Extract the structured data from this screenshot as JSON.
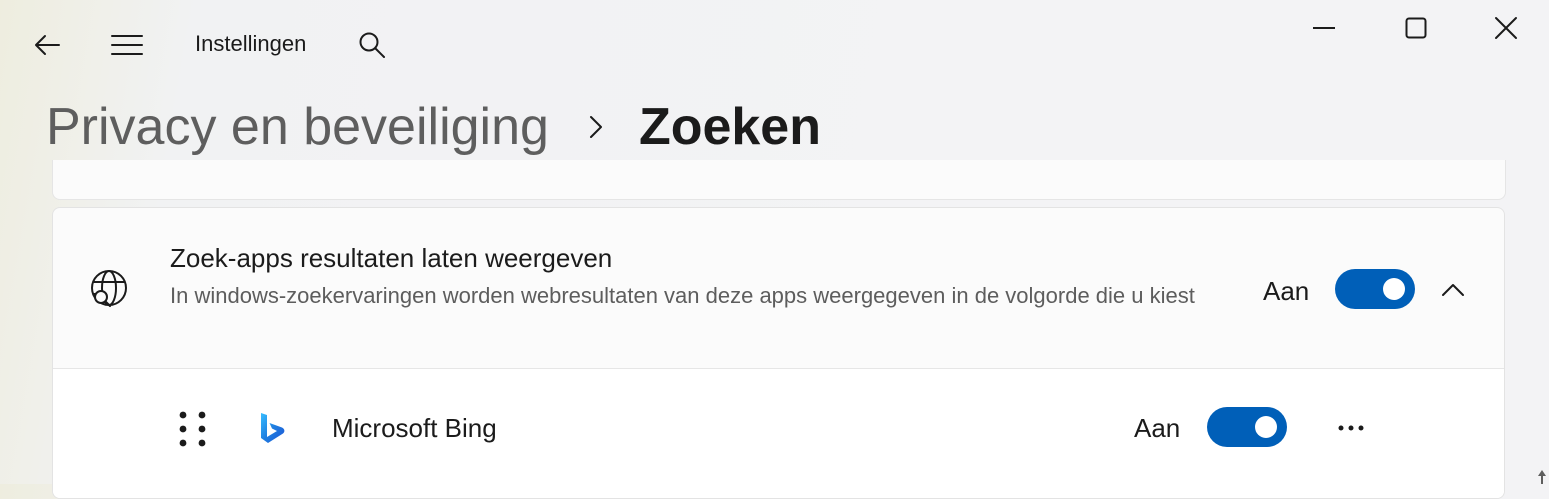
{
  "window": {
    "app_title": "Instellingen",
    "icons": {
      "back": "back-arrow-icon",
      "menu": "hamburger-menu-icon",
      "search": "search-icon",
      "minimize": "minimize-icon",
      "maximize": "maximize-icon",
      "close": "close-icon"
    }
  },
  "breadcrumb": {
    "parent": "Privacy en beveiliging",
    "separator_icon": "chevron-right-icon",
    "current": "Zoeken"
  },
  "search_apps_card": {
    "icon": "globe-search-icon",
    "title": "Zoek-apps resultaten laten weergeven",
    "description": "In windows-zoekervaringen worden webresultaten van deze apps weergegeven in de volgorde die u kiest",
    "toggle_label": "Aan",
    "toggle_on": true,
    "expand_icon": "chevron-up-icon",
    "apps": [
      {
        "name": "Microsoft Bing",
        "icon": "bing-logo-icon",
        "toggle_label": "Aan",
        "toggle_on": true,
        "more_icon": "more-options-icon",
        "drag_icon": "drag-handle-icon"
      }
    ]
  },
  "colors": {
    "accent": "#005fb8",
    "background": "#f3f3f5",
    "card": "#fbfbfb",
    "text_secondary": "#5d5d5d"
  }
}
